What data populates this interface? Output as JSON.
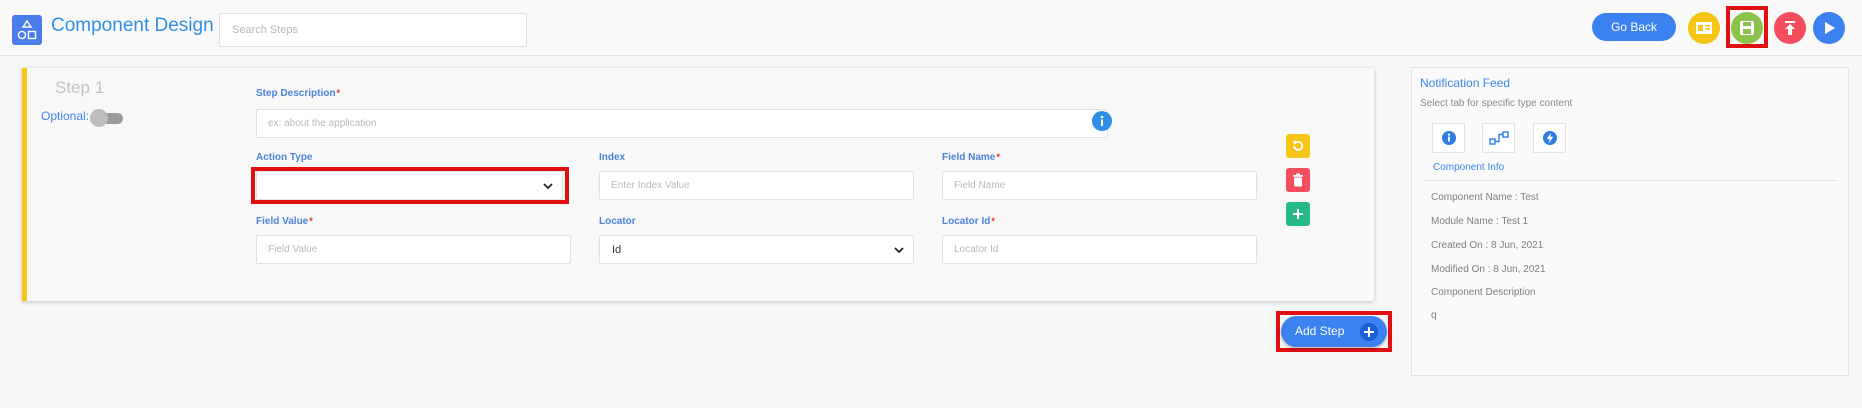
{
  "header": {
    "title": "Component Design",
    "search_placeholder": "Search Steps",
    "go_back_label": "Go Back"
  },
  "toolbar_icons": {
    "preview": "id-card-icon",
    "save": "save-icon",
    "upload": "upload-icon",
    "run": "play-icon"
  },
  "colors": {
    "accent": "#3b82f0",
    "yellow": "#f5c518",
    "green": "#8bc34a",
    "red": "#f44e5c",
    "highlight": "#e01010"
  },
  "step": {
    "title": "Step 1",
    "optional_label": "Optional:",
    "description": {
      "label": "Step Description",
      "required": "*",
      "placeholder": "ex: about the application",
      "value": ""
    },
    "action_type": {
      "label": "Action Type",
      "value": ""
    },
    "index": {
      "label": "Index",
      "placeholder": "Enter Index Value",
      "value": ""
    },
    "field_name": {
      "label": "Field Name",
      "required": "*",
      "placeholder": "Field Name",
      "value": ""
    },
    "field_value": {
      "label": "Field Value",
      "required": "*",
      "placeholder": "Field Value",
      "value": ""
    },
    "locator": {
      "label": "Locator",
      "value": "Id"
    },
    "locator_id": {
      "label": "Locator Id",
      "required": "*",
      "placeholder": "Locator Id",
      "value": ""
    }
  },
  "add_step_label": "Add Step",
  "notification_feed": {
    "title": "Notification Feed",
    "subtitle": "Select tab for specific type content",
    "active_tab_label": "Component Info",
    "tabs": [
      "info-icon",
      "flow-icon",
      "bolt-icon"
    ],
    "info": [
      "Component Name : Test",
      "Module Name : Test 1",
      "Created On : 8 Jun, 2021",
      "Modified On : 8 Jun, 2021",
      "Component Description",
      "q"
    ]
  }
}
